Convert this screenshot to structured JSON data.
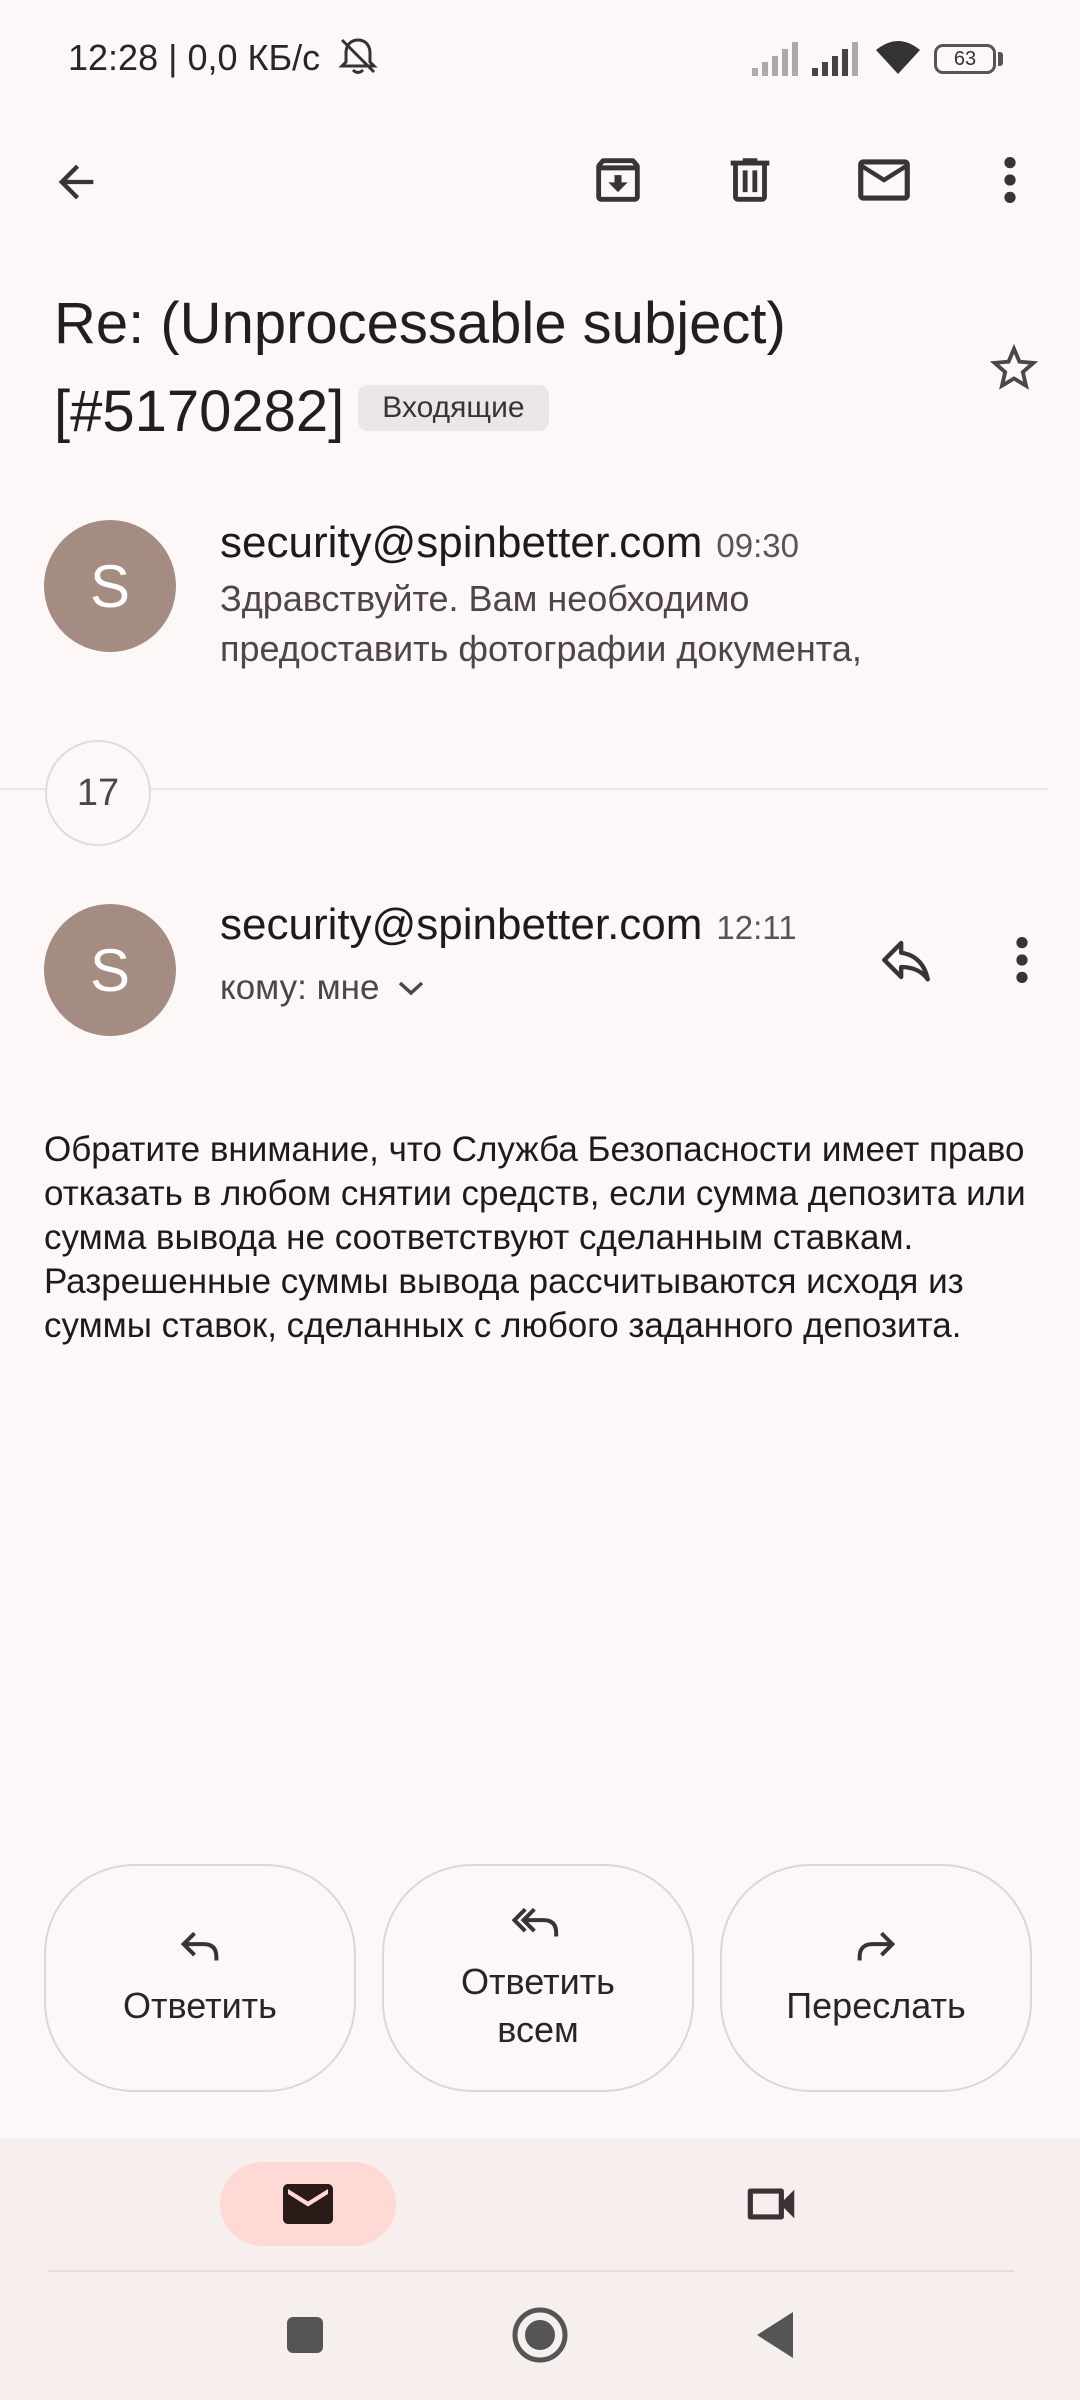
{
  "status_bar": {
    "time_speed": "12:28 | 0,0 КБ/с",
    "battery": "63"
  },
  "toolbar": {
    "back": "arrow-back-icon",
    "archive": "archive-icon",
    "delete": "trash-icon",
    "unread": "mail-icon",
    "more": "more-vert-icon"
  },
  "subject": {
    "text": "Re: (Unprocessable subject) [#5170282]",
    "label": "Входящие"
  },
  "collapsed_message": {
    "avatar_letter": "S",
    "sender": "security@spinbetter.com",
    "time": "09:30",
    "snippet": "Здравствуйте. Вам необходимо предоставить фотографии документа,"
  },
  "hidden_count": "17",
  "open_message": {
    "avatar_letter": "S",
    "sender": "security@spinbetter.com",
    "time": "12:11",
    "recipient": "кому: мне",
    "body": [
      "Обратите внимание, что Служба Безопасности имеет право отказать в любом снятии средств, если сумма депозита или сумма вывода не соответствуют сделанным ставкам.",
      "Разрешенные суммы вывода рассчитываются исходя из суммы ставок, сделанных с любого заданного депозита."
    ]
  },
  "actions": {
    "reply": "Ответить",
    "reply_all": "Ответить всем",
    "forward": "Переслать"
  },
  "colors": {
    "background": "#fdf8f7",
    "avatar": "#a58c83",
    "mail_tab_active": "#ffdad4"
  }
}
